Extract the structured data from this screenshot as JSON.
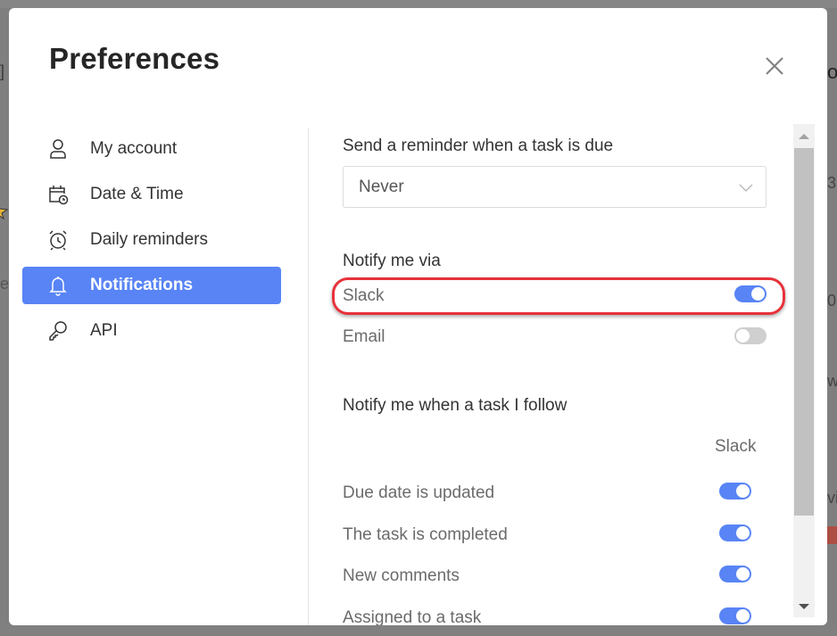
{
  "background": {
    "fragments": [
      "]",
      "e",
      "3",
      "0",
      "w",
      "vi",
      "oc"
    ],
    "star_color": "#e7b43a",
    "red_fragment_color": "#c0392b"
  },
  "modal": {
    "title": "Preferences",
    "close_icon": "close-icon"
  },
  "sidebar": {
    "items": [
      {
        "label": "My account",
        "icon": "user-icon",
        "active": false
      },
      {
        "label": "Date & Time",
        "icon": "calendar-clock-icon",
        "active": false
      },
      {
        "label": "Daily reminders",
        "icon": "alarm-clock-icon",
        "active": false
      },
      {
        "label": "Notifications",
        "icon": "bell-icon",
        "active": true
      },
      {
        "label": "API",
        "icon": "key-icon",
        "active": false
      }
    ],
    "active_color": "#5884f5"
  },
  "content": {
    "reminder": {
      "label": "Send a reminder when a task is due",
      "selected": "Never"
    },
    "notify_via": {
      "heading": "Notify me via",
      "channels": [
        {
          "label": "Slack",
          "enabled": true,
          "highlighted": true
        },
        {
          "label": "Email",
          "enabled": false,
          "highlighted": false
        }
      ]
    },
    "follow": {
      "heading": "Notify me when a task I follow",
      "column_header": "Slack",
      "rows": [
        {
          "label": "Due date is updated",
          "slack": true
        },
        {
          "label": "The task is completed",
          "slack": true
        },
        {
          "label": "New comments",
          "slack": true
        },
        {
          "label": "Assigned to a task",
          "slack": true
        }
      ]
    }
  },
  "colors": {
    "accent": "#5884f5",
    "highlight_ring": "#e8313b",
    "toggle_off": "#cfcfcf"
  }
}
